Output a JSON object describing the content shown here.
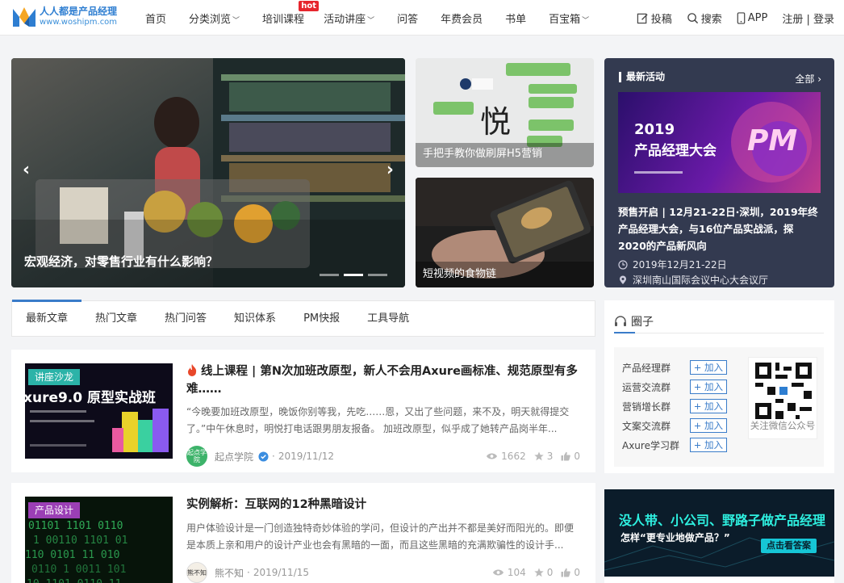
{
  "site": {
    "logo_title": "人人都是产品经理",
    "logo_url": "www.woshipm.com"
  },
  "nav": {
    "items": [
      {
        "label": "首页",
        "dropdown": false
      },
      {
        "label": "分类浏览",
        "dropdown": true
      },
      {
        "label": "培训课程",
        "dropdown": false,
        "badge": "hot"
      },
      {
        "label": "活动讲座",
        "dropdown": true
      },
      {
        "label": "问答",
        "dropdown": false
      },
      {
        "label": "年费会员",
        "dropdown": false
      },
      {
        "label": "书单",
        "dropdown": false
      },
      {
        "label": "百宝箱",
        "dropdown": true
      }
    ],
    "contribute": "投稿",
    "search": "搜索",
    "app": "APP",
    "auth": "注册 | 登录"
  },
  "hero": {
    "caption": "宏观经济，对零售行业有什么影响？",
    "slide_count": 3,
    "active_slide": 2
  },
  "tiles": [
    {
      "caption": "手把手教你做刷屏H5营销"
    },
    {
      "caption": "短视频的食物链"
    }
  ],
  "activity": {
    "heading": "最新活动",
    "more": "全部",
    "banner_year": "2019",
    "banner_title": "产品经理大会",
    "banner_logo": "PM",
    "title": "预售开启 | 12月21-22日·深圳，2019年终产品经理大会，与16位产品实战派，探2020的产品新风向",
    "date": "2019年12月21-22日",
    "location": "深圳南山国际会议中心大会议厅"
  },
  "tabs": [
    {
      "label": "最新文章",
      "active": true
    },
    {
      "label": "热门文章",
      "active": false
    },
    {
      "label": "热门问答",
      "active": false
    },
    {
      "label": "知识体系",
      "active": false
    },
    {
      "label": "PM快报",
      "active": false
    },
    {
      "label": "工具导航",
      "active": false
    }
  ],
  "articles": [
    {
      "badge": "讲座沙龙",
      "badge_color": "#2bb3a8",
      "thumb_text": "xure9.0 原型实战班",
      "title": "线上课程 | 第N次加班改原型，新人不会用Axure画标准、规范原型有多难……",
      "excerpt": "“今晚要加班改原型，晚饭你别等我，先吃……恩，又出了些问题，来不及，明天就得提交了。”中午休息时，明悦打电话跟男朋友报备。 加班改原型，似乎成了她转产品岗半年...",
      "author": "起点学院",
      "avatar_text": "起点学院",
      "date": "2019/11/12",
      "views": "1662",
      "stars": "3",
      "likes": "0"
    },
    {
      "badge": "产品设计",
      "badge_color": "#9b3fb5",
      "title": "实例解析：互联网的12种黑暗设计",
      "excerpt": "用户体验设计是一门创造独特奇妙体验的学问，但设计的产出并不都是美好而阳光的。即便是本质上亲和用户的设计产业也会有黑暗的一面，而且这些黑暗的充满欺骗性的设计手...",
      "author": "熊不知",
      "avatar_text": "熊不知",
      "date": "2019/11/15",
      "views": "104",
      "stars": "0",
      "likes": "0"
    }
  ],
  "circles": {
    "heading": "圈子",
    "groups": [
      "产品经理群",
      "运营交流群",
      "营销增长群",
      "文案交流群",
      "Axure学习群"
    ],
    "join_label": "+ 加入",
    "qr_caption": "关注微信公众号"
  },
  "promo": {
    "line1": "没人带、小公司、野路子做产品经理",
    "line2": "怎样“更专业地做产品？”",
    "button": "点击看答案"
  },
  "colors": {
    "accent": "#3a7cc9",
    "activity_bg": "#333a50",
    "hot": "#e6262e"
  }
}
